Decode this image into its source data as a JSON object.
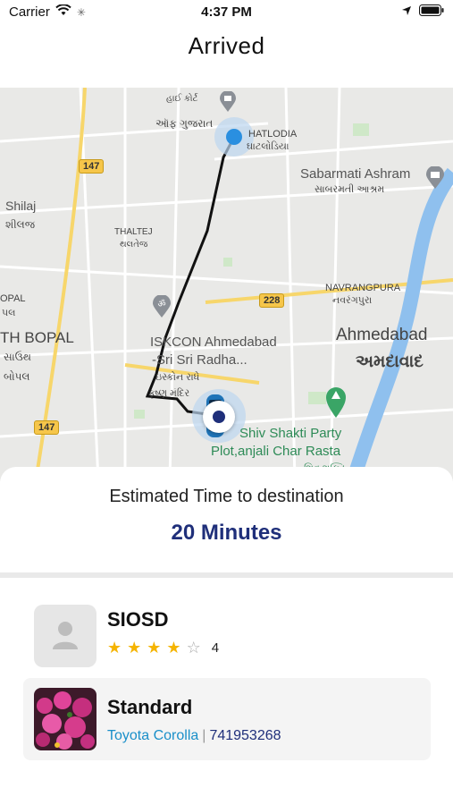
{
  "status_bar": {
    "carrier": "Carrier",
    "time": "4:37 PM"
  },
  "nav": {
    "title": "Arrived"
  },
  "map": {
    "labels": {
      "hai_court": "હાઈ કોર્ટ",
      "of_gujarat": "ઑફ ગુજરાત",
      "ghatlodia_en": "HATLODIA",
      "ghatlodia_gu": "ઘાટલોડિયા",
      "sabarmati_en": "Sabarmati Ashram",
      "sabarmati_gu": "સાબરમતી આશ્રમ",
      "shilaj_en": "Shilaj",
      "shilaj_gu": "શીલજ",
      "thaltej_en": "THALTEJ",
      "thaltej_gu": "થલતેજ",
      "bopal_short_en": "OPAL",
      "bopal_short_gu": "પલ",
      "south_bopal_en": "TH BOPAL",
      "south_bopal_gu1": "સાઉથ",
      "south_bopal_gu2": "બોપલ",
      "navrangpura_en": "NAVRANGPURA",
      "navrangpura_gu": "નવરંગપુરા",
      "ahmedabad_en": "Ahmedabad",
      "ahmedabad_gu": "અમદાવાદ",
      "iskcon_1": "ISKCON Ahmedabad",
      "iskcon_2": "-Sri Sri Radha...",
      "iskcon_3": "ઇસ્કોન રાધે",
      "iskcon_4": "કૃષ્ણ મંદિર",
      "shiv_1": "Shiv Shakti Party",
      "shiv_2": "Plot,anjali Char Rasta",
      "shiv_3": "શિવ શક્તિ..."
    },
    "road_shields": [
      "147",
      "228",
      "147"
    ]
  },
  "estimate": {
    "label": "Estimated Time to destination",
    "value": "20 Minutes"
  },
  "driver": {
    "name": "SIOSD",
    "rating": 4,
    "rating_text": "4"
  },
  "vehicle": {
    "type": "Standard",
    "model": "Toyota Corolla",
    "separator": "|",
    "plate": "741953268"
  },
  "colors": {
    "accent_navy": "#1f2f7a",
    "link_blue": "#1a8fc9",
    "star": "#f5b400",
    "route": "#111111",
    "river": "#7fb6ea"
  }
}
